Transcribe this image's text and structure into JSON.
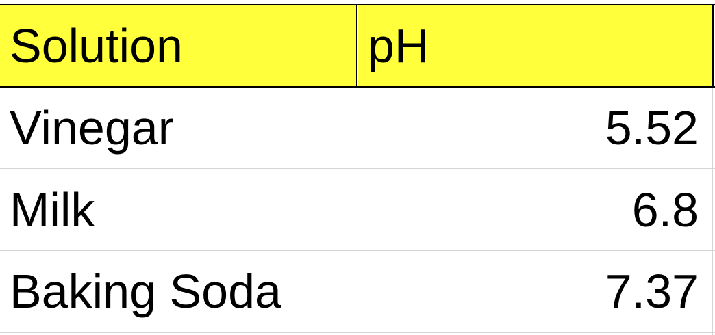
{
  "header": {
    "solution_label": "Solution",
    "ph_label": "pH",
    "fill_color": "#ffff3b"
  },
  "rows": [
    {
      "solution": "Vinegar",
      "ph": "5.52"
    },
    {
      "solution": "Milk",
      "ph": "6.8"
    },
    {
      "solution": "Baking Soda",
      "ph": "7.37"
    }
  ]
}
